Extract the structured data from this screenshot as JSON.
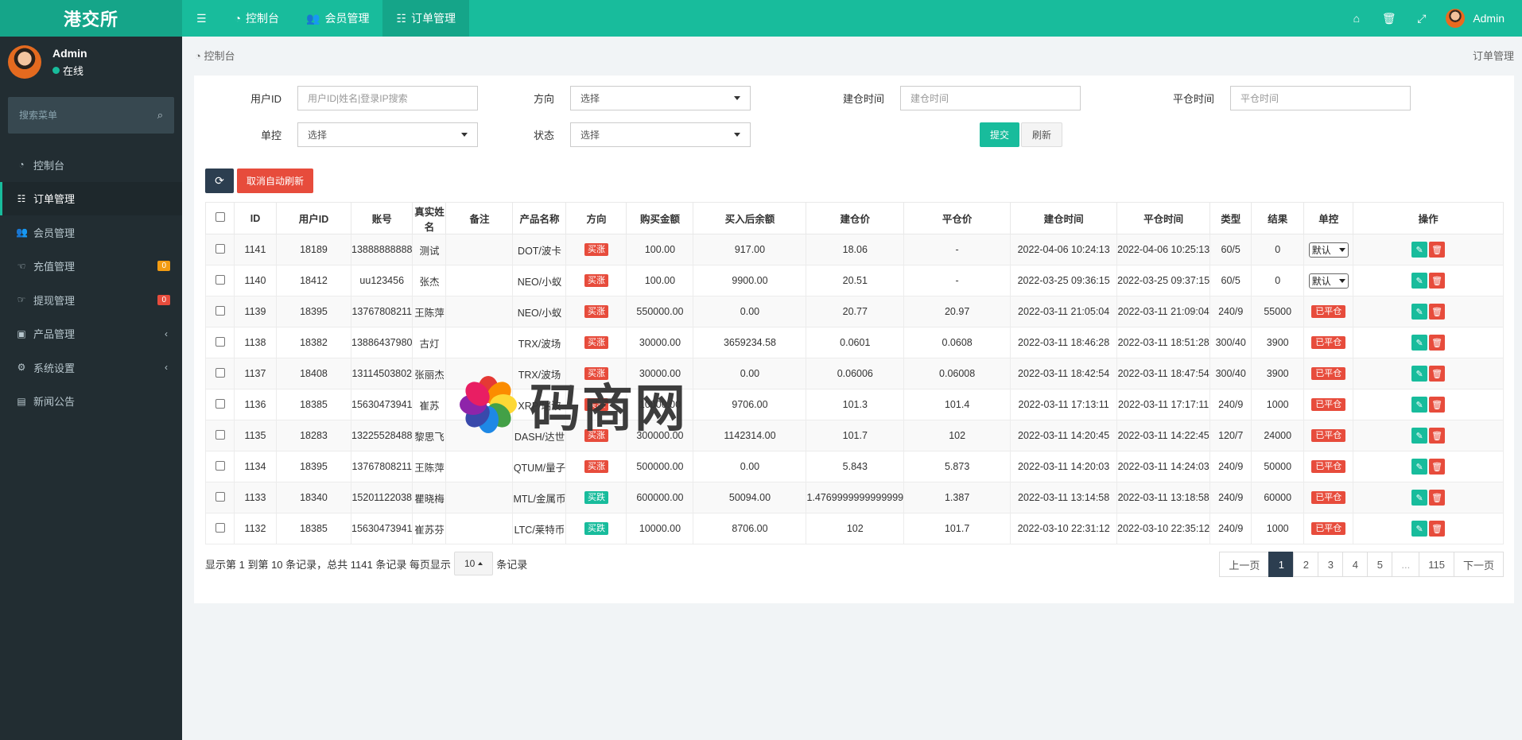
{
  "topbar": {
    "logo": "港交所",
    "nav": [
      {
        "label": "控制台",
        "icon": "dashboard-icon"
      },
      {
        "label": "会员管理",
        "icon": "users-icon"
      },
      {
        "label": "订单管理",
        "icon": "list-icon"
      }
    ],
    "user_name": "Admin",
    "right_icons": [
      "home-icon",
      "trash-icon",
      "fullscreen-icon"
    ]
  },
  "sidebar": {
    "user_name": "Admin",
    "status": "在线",
    "search_placeholder": "搜索菜单",
    "items": [
      {
        "label": "控制台",
        "icon": "dashboard-icon"
      },
      {
        "label": "订单管理",
        "icon": "list-icon",
        "active": true
      },
      {
        "label": "会员管理",
        "icon": "users-icon"
      },
      {
        "label": "充值管理",
        "icon": "hand-icon",
        "badge": "0"
      },
      {
        "label": "提现管理",
        "icon": "hand-right-icon",
        "badge": "0"
      },
      {
        "label": "产品管理",
        "icon": "shopping-bag-icon"
      },
      {
        "label": "系统设置",
        "icon": "cogs-icon"
      },
      {
        "label": "新闻公告",
        "icon": "newspaper-icon"
      }
    ]
  },
  "breadcrumb": {
    "left": "控制台",
    "right": "订单管理"
  },
  "filter": {
    "user_id_label": "用户ID",
    "user_id_placeholder": "用户ID|姓名|登录IP搜索",
    "direction_label": "方向",
    "direction_value": "选择",
    "open_time_label": "建仓时间",
    "open_time_placeholder": "建仓时间",
    "close_time_label": "平仓时间",
    "close_time_placeholder": "平仓时间",
    "control_label": "单控",
    "control_value": "选择",
    "status_label": "状态",
    "status_value": "选择",
    "submit_label": "提交",
    "reset_label": "刷新"
  },
  "toolbar": {
    "cancel_auto_refresh": "取消自动刷新"
  },
  "table": {
    "headers": [
      "ID",
      "用户ID",
      "账号",
      "真实姓名",
      "备注",
      "产品名称",
      "方向",
      "购买金额",
      "买入后余额",
      "建仓价",
      "平仓价",
      "建仓时间",
      "平仓时间",
      "类型",
      "结果",
      "单控",
      "操作"
    ],
    "rows": [
      [
        "1141",
        "18189",
        "13888888888",
        "测试",
        "",
        "DOT/波卡",
        "买涨",
        "100.00",
        "917.00",
        "18.06",
        "-",
        "2022-04-06 10:24:13",
        "2022-04-06 10:25:13",
        "60/5",
        "0",
        "默认"
      ],
      [
        "1140",
        "18412",
        "uu123456",
        "张杰",
        "",
        "NEO/小蚁",
        "买涨",
        "100.00",
        "9900.00",
        "20.51",
        "-",
        "2022-03-25 09:36:15",
        "2022-03-25 09:37:15",
        "60/5",
        "0",
        "默认"
      ],
      [
        "1139",
        "18395",
        "13767808211",
        "王陈萍",
        "",
        "NEO/小蚁",
        "买涨",
        "550000.00",
        "0.00",
        "20.77",
        "20.97",
        "2022-03-11 21:05:04",
        "2022-03-11 21:09:04",
        "240/9",
        "55000",
        "已平仓"
      ],
      [
        "1138",
        "18382",
        "13886437980",
        "古灯",
        "",
        "TRX/波场",
        "买涨",
        "30000.00",
        "3659234.58",
        "0.0601",
        "0.0608",
        "2022-03-11 18:46:28",
        "2022-03-11 18:51:28",
        "300/40",
        "3900",
        "已平仓"
      ],
      [
        "1137",
        "18408",
        "13114503802",
        "张丽杰",
        "",
        "TRX/波场",
        "买涨",
        "30000.00",
        "0.00",
        "0.06006",
        "0.06008",
        "2022-03-11 18:42:54",
        "2022-03-11 18:47:54",
        "300/40",
        "3900",
        "已平仓"
      ],
      [
        "1136",
        "18385",
        "15630473941",
        "崔苏",
        "",
        "XRP/瑞波",
        "买涨",
        "10000.00",
        "9706.00",
        "101.3",
        "101.4",
        "2022-03-11 17:13:11",
        "2022-03-11 17:17:11",
        "240/9",
        "1000",
        "已平仓"
      ],
      [
        "1135",
        "18283",
        "13225528488",
        "黎思飞",
        "",
        "DASH/达世",
        "买涨",
        "300000.00",
        "1142314.00",
        "101.7",
        "102",
        "2022-03-11 14:20:45",
        "2022-03-11 14:22:45",
        "120/7",
        "24000",
        "已平仓"
      ],
      [
        "1134",
        "18395",
        "13767808211",
        "王陈萍",
        "",
        "QTUM/量子",
        "买涨",
        "500000.00",
        "0.00",
        "5.843",
        "5.873",
        "2022-03-11 14:20:03",
        "2022-03-11 14:24:03",
        "240/9",
        "50000",
        "已平仓"
      ],
      [
        "1133",
        "18340",
        "15201122038",
        "瞿晓梅",
        "",
        "MTL/金属币",
        "买跌",
        "600000.00",
        "50094.00",
        "1.4769999999999999",
        "1.387",
        "2022-03-11 13:14:58",
        "2022-03-11 13:18:58",
        "240/9",
        "60000",
        "已平仓"
      ],
      [
        "1132",
        "18385",
        "15630473941",
        "崔苏芬",
        "",
        "LTC/莱特币",
        "买跌",
        "10000.00",
        "8706.00",
        "102",
        "101.7",
        "2022-03-10 22:31:12",
        "2022-03-10 22:35:12",
        "240/9",
        "1000",
        "已平仓"
      ]
    ]
  },
  "footer": {
    "info_prefix": "显示第 1 到第 10 条记录，总共 1141 条记录 每页显示",
    "page_size": "10",
    "info_suffix": "条记录"
  },
  "pagination": [
    "上一页",
    "1",
    "2",
    "3",
    "4",
    "5",
    "...",
    "115",
    "下一页"
  ],
  "watermark": "码商网",
  "colors": {
    "accent": "#18bc9c",
    "sidebar": "#222d32",
    "danger": "#e74c3c",
    "dark": "#2c3e50",
    "warning": "#f39c12"
  }
}
